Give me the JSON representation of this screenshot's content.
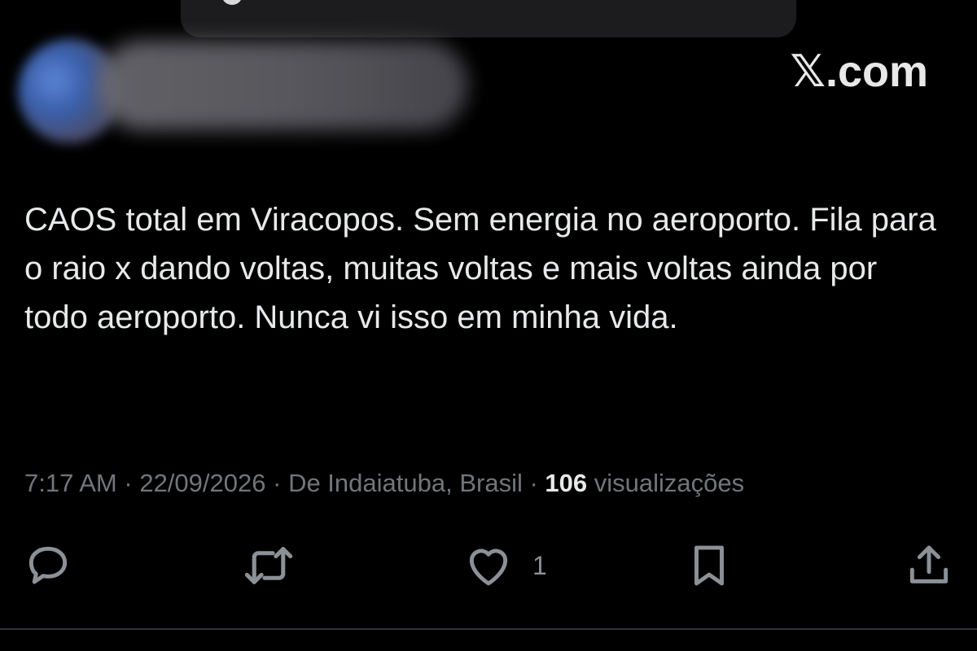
{
  "header": {
    "site_label": "𝕏.com"
  },
  "tweet": {
    "text": "CAOS total em Viracopos. Sem energia no aeroporto. Fila para o raio x dando voltas, muitas voltas e mais voltas ainda por todo aeroporto. Nunca vi isso em minha vida.",
    "time": "7:17 AM",
    "date": "22/09/2026",
    "location": "De Indaiatuba, Brasil",
    "views_count": "106",
    "views_label": "visualizações",
    "separator": "·"
  },
  "actions": {
    "reply_icon": "reply-icon",
    "retweet_icon": "retweet-icon",
    "like_icon": "heart-icon",
    "like_count": "1",
    "bookmark_icon": "bookmark-icon",
    "share_icon": "share-icon"
  },
  "colors": {
    "background": "#000000",
    "text": "#e7e9ea",
    "muted": "#71767b",
    "divider": "#2f3336"
  }
}
